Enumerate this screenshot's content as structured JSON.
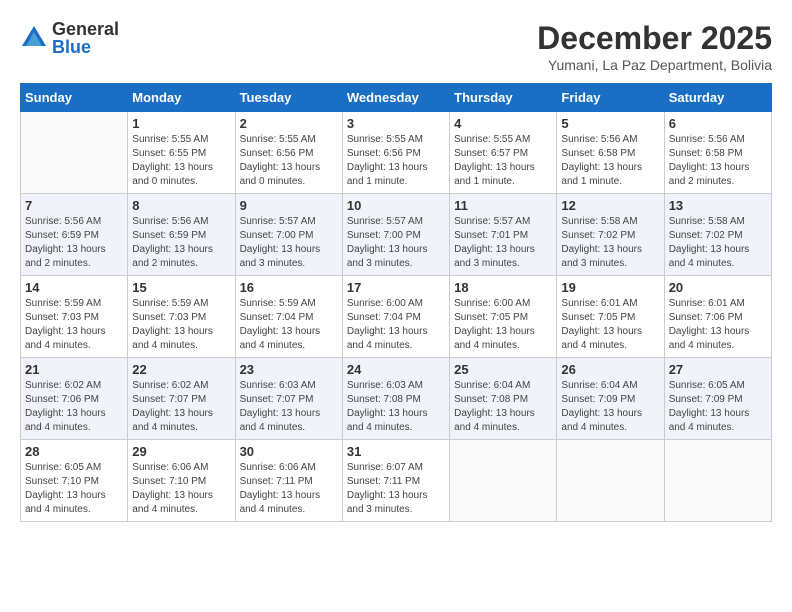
{
  "logo": {
    "general": "General",
    "blue": "Blue"
  },
  "title": {
    "month": "December 2025",
    "location": "Yumani, La Paz Department, Bolivia"
  },
  "weekdays": [
    "Sunday",
    "Monday",
    "Tuesday",
    "Wednesday",
    "Thursday",
    "Friday",
    "Saturday"
  ],
  "weeks": [
    [
      {
        "day": "",
        "sunrise": "",
        "sunset": "",
        "daylight": ""
      },
      {
        "day": "1",
        "sunrise": "Sunrise: 5:55 AM",
        "sunset": "Sunset: 6:55 PM",
        "daylight": "Daylight: 13 hours and 0 minutes."
      },
      {
        "day": "2",
        "sunrise": "Sunrise: 5:55 AM",
        "sunset": "Sunset: 6:56 PM",
        "daylight": "Daylight: 13 hours and 0 minutes."
      },
      {
        "day": "3",
        "sunrise": "Sunrise: 5:55 AM",
        "sunset": "Sunset: 6:56 PM",
        "daylight": "Daylight: 13 hours and 1 minute."
      },
      {
        "day": "4",
        "sunrise": "Sunrise: 5:55 AM",
        "sunset": "Sunset: 6:57 PM",
        "daylight": "Daylight: 13 hours and 1 minute."
      },
      {
        "day": "5",
        "sunrise": "Sunrise: 5:56 AM",
        "sunset": "Sunset: 6:58 PM",
        "daylight": "Daylight: 13 hours and 1 minute."
      },
      {
        "day": "6",
        "sunrise": "Sunrise: 5:56 AM",
        "sunset": "Sunset: 6:58 PM",
        "daylight": "Daylight: 13 hours and 2 minutes."
      }
    ],
    [
      {
        "day": "7",
        "sunrise": "Sunrise: 5:56 AM",
        "sunset": "Sunset: 6:59 PM",
        "daylight": "Daylight: 13 hours and 2 minutes."
      },
      {
        "day": "8",
        "sunrise": "Sunrise: 5:56 AM",
        "sunset": "Sunset: 6:59 PM",
        "daylight": "Daylight: 13 hours and 2 minutes."
      },
      {
        "day": "9",
        "sunrise": "Sunrise: 5:57 AM",
        "sunset": "Sunset: 7:00 PM",
        "daylight": "Daylight: 13 hours and 3 minutes."
      },
      {
        "day": "10",
        "sunrise": "Sunrise: 5:57 AM",
        "sunset": "Sunset: 7:00 PM",
        "daylight": "Daylight: 13 hours and 3 minutes."
      },
      {
        "day": "11",
        "sunrise": "Sunrise: 5:57 AM",
        "sunset": "Sunset: 7:01 PM",
        "daylight": "Daylight: 13 hours and 3 minutes."
      },
      {
        "day": "12",
        "sunrise": "Sunrise: 5:58 AM",
        "sunset": "Sunset: 7:02 PM",
        "daylight": "Daylight: 13 hours and 3 minutes."
      },
      {
        "day": "13",
        "sunrise": "Sunrise: 5:58 AM",
        "sunset": "Sunset: 7:02 PM",
        "daylight": "Daylight: 13 hours and 4 minutes."
      }
    ],
    [
      {
        "day": "14",
        "sunrise": "Sunrise: 5:59 AM",
        "sunset": "Sunset: 7:03 PM",
        "daylight": "Daylight: 13 hours and 4 minutes."
      },
      {
        "day": "15",
        "sunrise": "Sunrise: 5:59 AM",
        "sunset": "Sunset: 7:03 PM",
        "daylight": "Daylight: 13 hours and 4 minutes."
      },
      {
        "day": "16",
        "sunrise": "Sunrise: 5:59 AM",
        "sunset": "Sunset: 7:04 PM",
        "daylight": "Daylight: 13 hours and 4 minutes."
      },
      {
        "day": "17",
        "sunrise": "Sunrise: 6:00 AM",
        "sunset": "Sunset: 7:04 PM",
        "daylight": "Daylight: 13 hours and 4 minutes."
      },
      {
        "day": "18",
        "sunrise": "Sunrise: 6:00 AM",
        "sunset": "Sunset: 7:05 PM",
        "daylight": "Daylight: 13 hours and 4 minutes."
      },
      {
        "day": "19",
        "sunrise": "Sunrise: 6:01 AM",
        "sunset": "Sunset: 7:05 PM",
        "daylight": "Daylight: 13 hours and 4 minutes."
      },
      {
        "day": "20",
        "sunrise": "Sunrise: 6:01 AM",
        "sunset": "Sunset: 7:06 PM",
        "daylight": "Daylight: 13 hours and 4 minutes."
      }
    ],
    [
      {
        "day": "21",
        "sunrise": "Sunrise: 6:02 AM",
        "sunset": "Sunset: 7:06 PM",
        "daylight": "Daylight: 13 hours and 4 minutes."
      },
      {
        "day": "22",
        "sunrise": "Sunrise: 6:02 AM",
        "sunset": "Sunset: 7:07 PM",
        "daylight": "Daylight: 13 hours and 4 minutes."
      },
      {
        "day": "23",
        "sunrise": "Sunrise: 6:03 AM",
        "sunset": "Sunset: 7:07 PM",
        "daylight": "Daylight: 13 hours and 4 minutes."
      },
      {
        "day": "24",
        "sunrise": "Sunrise: 6:03 AM",
        "sunset": "Sunset: 7:08 PM",
        "daylight": "Daylight: 13 hours and 4 minutes."
      },
      {
        "day": "25",
        "sunrise": "Sunrise: 6:04 AM",
        "sunset": "Sunset: 7:08 PM",
        "daylight": "Daylight: 13 hours and 4 minutes."
      },
      {
        "day": "26",
        "sunrise": "Sunrise: 6:04 AM",
        "sunset": "Sunset: 7:09 PM",
        "daylight": "Daylight: 13 hours and 4 minutes."
      },
      {
        "day": "27",
        "sunrise": "Sunrise: 6:05 AM",
        "sunset": "Sunset: 7:09 PM",
        "daylight": "Daylight: 13 hours and 4 minutes."
      }
    ],
    [
      {
        "day": "28",
        "sunrise": "Sunrise: 6:05 AM",
        "sunset": "Sunset: 7:10 PM",
        "daylight": "Daylight: 13 hours and 4 minutes."
      },
      {
        "day": "29",
        "sunrise": "Sunrise: 6:06 AM",
        "sunset": "Sunset: 7:10 PM",
        "daylight": "Daylight: 13 hours and 4 minutes."
      },
      {
        "day": "30",
        "sunrise": "Sunrise: 6:06 AM",
        "sunset": "Sunset: 7:11 PM",
        "daylight": "Daylight: 13 hours and 4 minutes."
      },
      {
        "day": "31",
        "sunrise": "Sunrise: 6:07 AM",
        "sunset": "Sunset: 7:11 PM",
        "daylight": "Daylight: 13 hours and 3 minutes."
      },
      {
        "day": "",
        "sunrise": "",
        "sunset": "",
        "daylight": ""
      },
      {
        "day": "",
        "sunrise": "",
        "sunset": "",
        "daylight": ""
      },
      {
        "day": "",
        "sunrise": "",
        "sunset": "",
        "daylight": ""
      }
    ]
  ]
}
